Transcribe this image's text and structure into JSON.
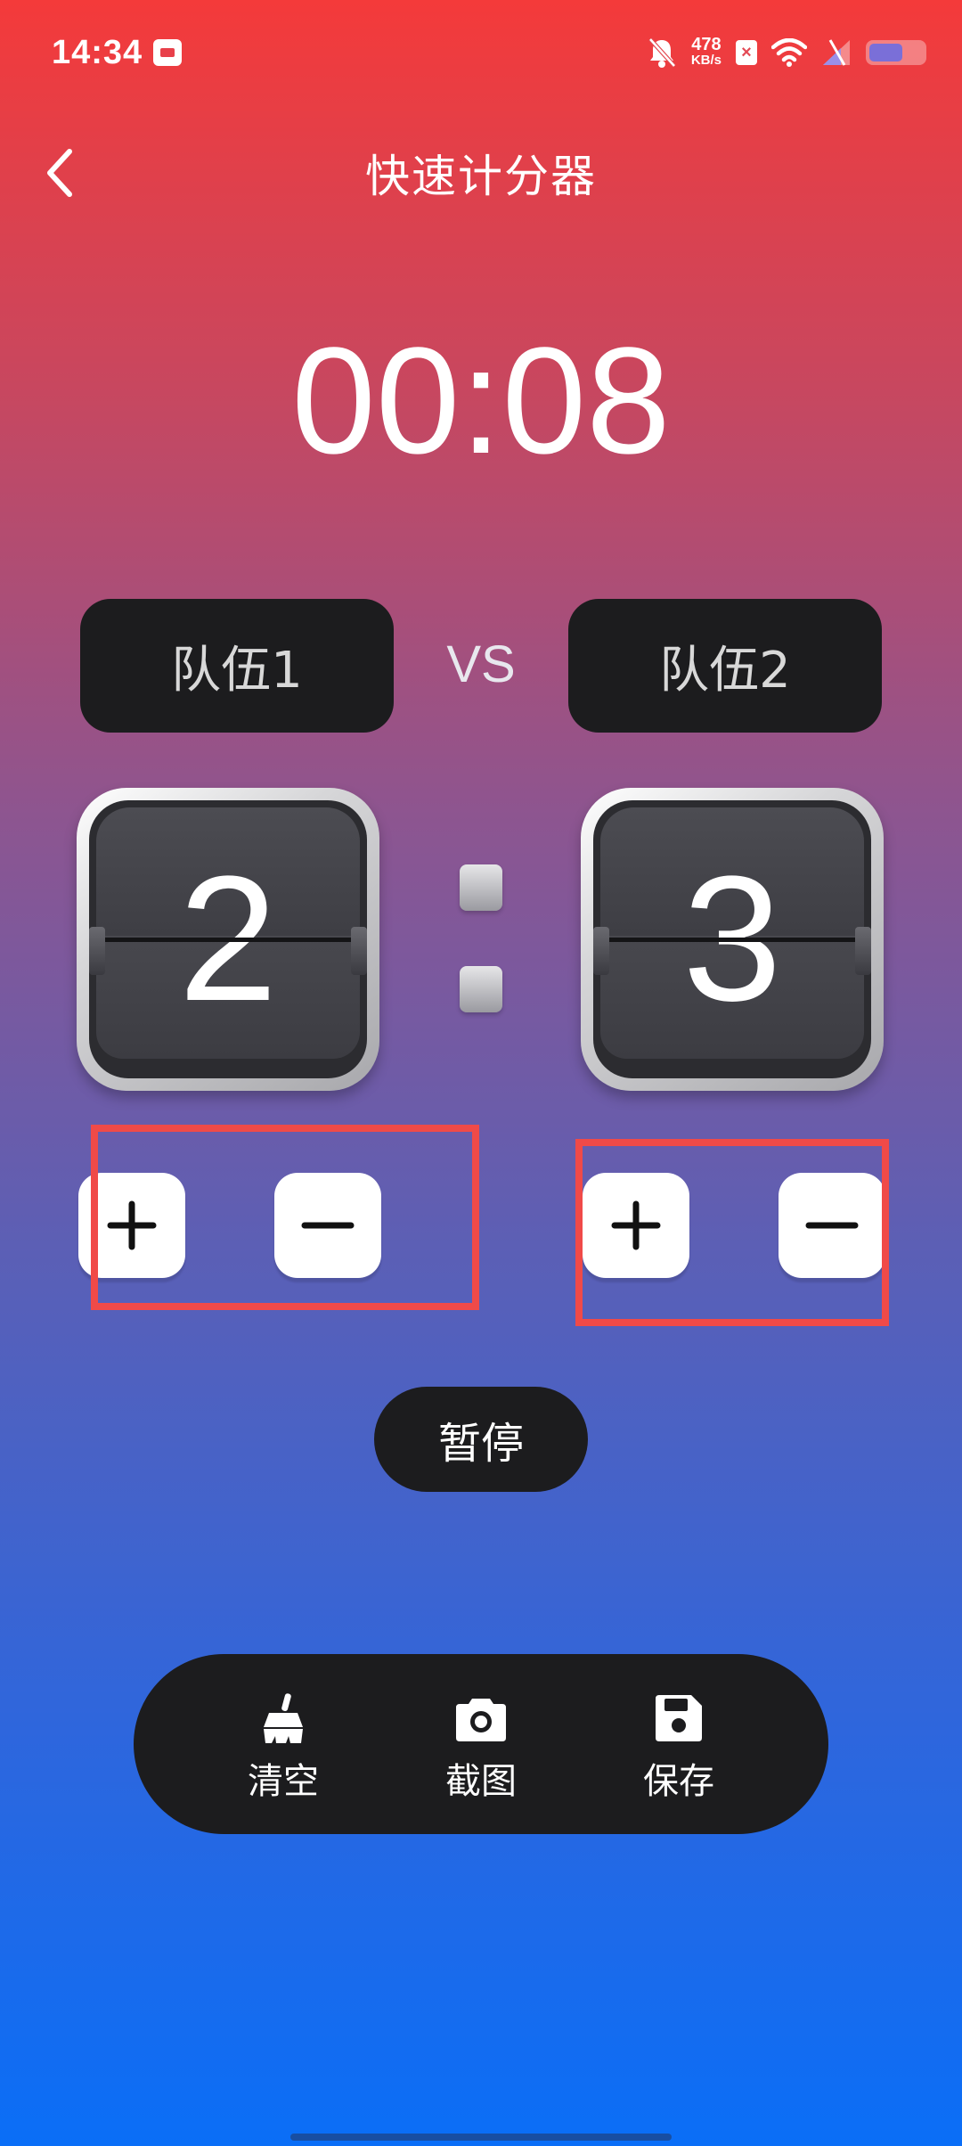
{
  "status_bar": {
    "time": "14:34",
    "net_speed_value": "478",
    "net_speed_unit": "KB/s",
    "sim_label": "×",
    "icons": [
      "calendar-app-icon",
      "mute-bell-icon",
      "sim-icon",
      "wifi-icon",
      "signal-icon",
      "battery-icon"
    ],
    "battery_level": 0.55
  },
  "header": {
    "title": "快速计分器",
    "back_icon": "chevron-left-icon"
  },
  "timer": {
    "display": "00:08"
  },
  "teams": {
    "left": {
      "name": "队伍1",
      "score": "2"
    },
    "right": {
      "name": "队伍2",
      "score": "3"
    },
    "vs": "VS"
  },
  "controls": {
    "plus_icon": "plus-icon",
    "minus_icon": "minus-icon",
    "highlight_color": "#f04a48"
  },
  "pause_label": "暂停",
  "toolbar": {
    "items": [
      {
        "label": "清空",
        "icon": "broom-icon"
      },
      {
        "label": "截图",
        "icon": "camera-icon"
      },
      {
        "label": "保存",
        "icon": "floppy-disk-icon"
      }
    ]
  },
  "colors": {
    "gradient_top": "#f43a3a",
    "gradient_bottom": "#0a6ef7",
    "panel_dark": "#1c1c1e"
  }
}
